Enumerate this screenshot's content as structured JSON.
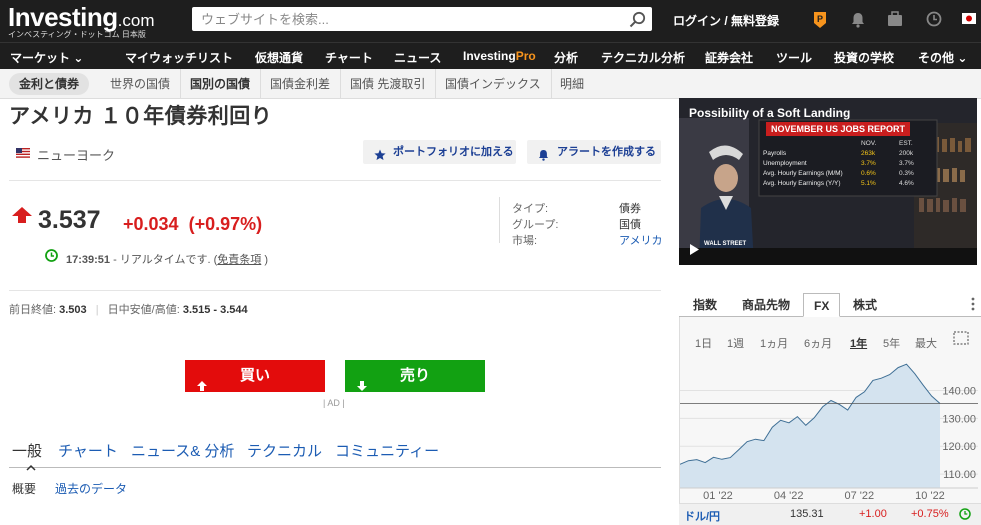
{
  "header": {
    "logo_main": "Investing",
    "logo_suffix": ".com",
    "logo_subtitle": "インベスティング・ドットコム 日本版",
    "search_placeholder": "ウェブサイトを検索...",
    "login_label": "ログイン / 無料登録",
    "icons": [
      "search-icon",
      "pro-icon",
      "bell-icon",
      "briefcase-icon",
      "clock-icon",
      "japan-flag-icon"
    ]
  },
  "main_nav": [
    {
      "label": "マーケット ⌄"
    },
    {
      "label": "マイウォッチリスト"
    },
    {
      "label": "仮想通貨"
    },
    {
      "label": "チャート"
    },
    {
      "label": "ニュース"
    },
    {
      "label": "Investing",
      "accent": "Pro"
    },
    {
      "label": "分析"
    },
    {
      "label": "テクニカル分析"
    },
    {
      "label": "証券会社"
    },
    {
      "label": "ツール"
    },
    {
      "label": "投資の学校"
    },
    {
      "label": "その他 ⌄"
    }
  ],
  "sub_nav": [
    "金利と債券",
    "世界の国債",
    "国別の国債",
    "国債金利差",
    "国債 先渡取引",
    "国債インデックス",
    "明細"
  ],
  "instrument": {
    "title": "アメリカ １０年債券利回り",
    "location": "ニューヨーク",
    "add_portfolio": "ポートフォリオに加える",
    "create_alert": "アラートを作成する",
    "price": "3.537",
    "change": "+0.034",
    "change_pct": "(+0.97%)",
    "time": "17:39:51",
    "realtime_text": " - リアルタイムです. (",
    "disclaimer": "免責条項",
    "realtime_close": " )",
    "info": [
      {
        "label": "タイプ:",
        "value": "債券",
        "link": false
      },
      {
        "label": "グループ:",
        "value": "国債",
        "link": false
      },
      {
        "label": "市場:",
        "value": "アメリカ",
        "link": true
      }
    ],
    "prev_close_label": "前日終値:",
    "prev_close": "3.503",
    "day_range_label": "日中安値/高値:",
    "day_range": "3.515 - 3.544",
    "buy_label": "買い",
    "sell_label": "売り",
    "ad_label": "| AD |"
  },
  "content_tabs": [
    "一般",
    "チャート",
    "ニュース& 分析",
    "テクニカル",
    "コミュニティー"
  ],
  "sub_tabs": [
    "概要",
    "過去のデータ"
  ],
  "video": {
    "title": "Possibility of a Soft Landing",
    "banner": "NOVEMBER US JOBS REPORT",
    "col1": "NOV.",
    "col2": "EST.",
    "rows": [
      {
        "label": "Payrolls",
        "v1": "263k",
        "v2": "200k"
      },
      {
        "label": "Unemployment",
        "v1": "3.7%",
        "v2": "3.7%"
      },
      {
        "label": "Avg. Hourly Earnings (M/M)",
        "v1": "0.6%",
        "v2": "0.3%"
      },
      {
        "label": "Avg. Hourly Earnings (Y/Y)",
        "v1": "5.1%",
        "v2": "4.6%"
      }
    ],
    "source": "WALL STREET"
  },
  "market_tabs": [
    "指数",
    "商品先物",
    "FX",
    "株式"
  ],
  "periods": [
    "1日",
    "1週",
    "1ヵ月",
    "6ヵ月",
    "1年",
    "5年",
    "最大"
  ],
  "selected_period": "1年",
  "fx_quote": {
    "pair": "ドル/円",
    "price": "135.31",
    "change": "+1.00",
    "change_pct": "+0.75%"
  },
  "chart_data": {
    "type": "area",
    "x_ticks": [
      "01 '22",
      "04 '22",
      "07 '22",
      "10 '22"
    ],
    "y_ticks": [
      110.0,
      120.0,
      130.0,
      140.0
    ],
    "ylim": [
      105,
      152
    ],
    "current_value": 135.31,
    "series": [
      {
        "values": [
          113.5,
          114.8,
          115.2,
          114.1,
          116.0,
          115.3,
          115.9,
          118.7,
          121.6,
          122.5,
          122.0,
          126.8,
          129.3,
          128.4,
          130.6,
          127.5,
          130.2,
          134.1,
          136.4,
          135.0,
          133.0,
          137.5,
          139.5,
          143.6,
          144.4,
          145.7,
          148.2,
          149.4,
          146.0,
          141.9,
          138.0,
          135.3
        ]
      }
    ]
  },
  "colors": {
    "up": "#d81e1e",
    "down": "#12a112",
    "link": "#1c5cb3",
    "bar": "#1e1e1e",
    "pro_accent": "#f7941d"
  }
}
